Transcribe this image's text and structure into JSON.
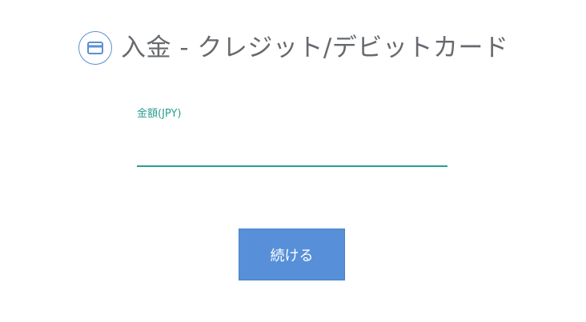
{
  "header": {
    "icon": "credit-card-icon",
    "title": "入金 - クレジット/デビットカード"
  },
  "form": {
    "amount": {
      "label": "金額(JPY)",
      "value": ""
    }
  },
  "actions": {
    "continue_label": "続ける"
  },
  "colors": {
    "accent": "#2a9d8f",
    "button": "#5790d9",
    "icon": "#5b8fd4",
    "title": "#666a6e"
  }
}
